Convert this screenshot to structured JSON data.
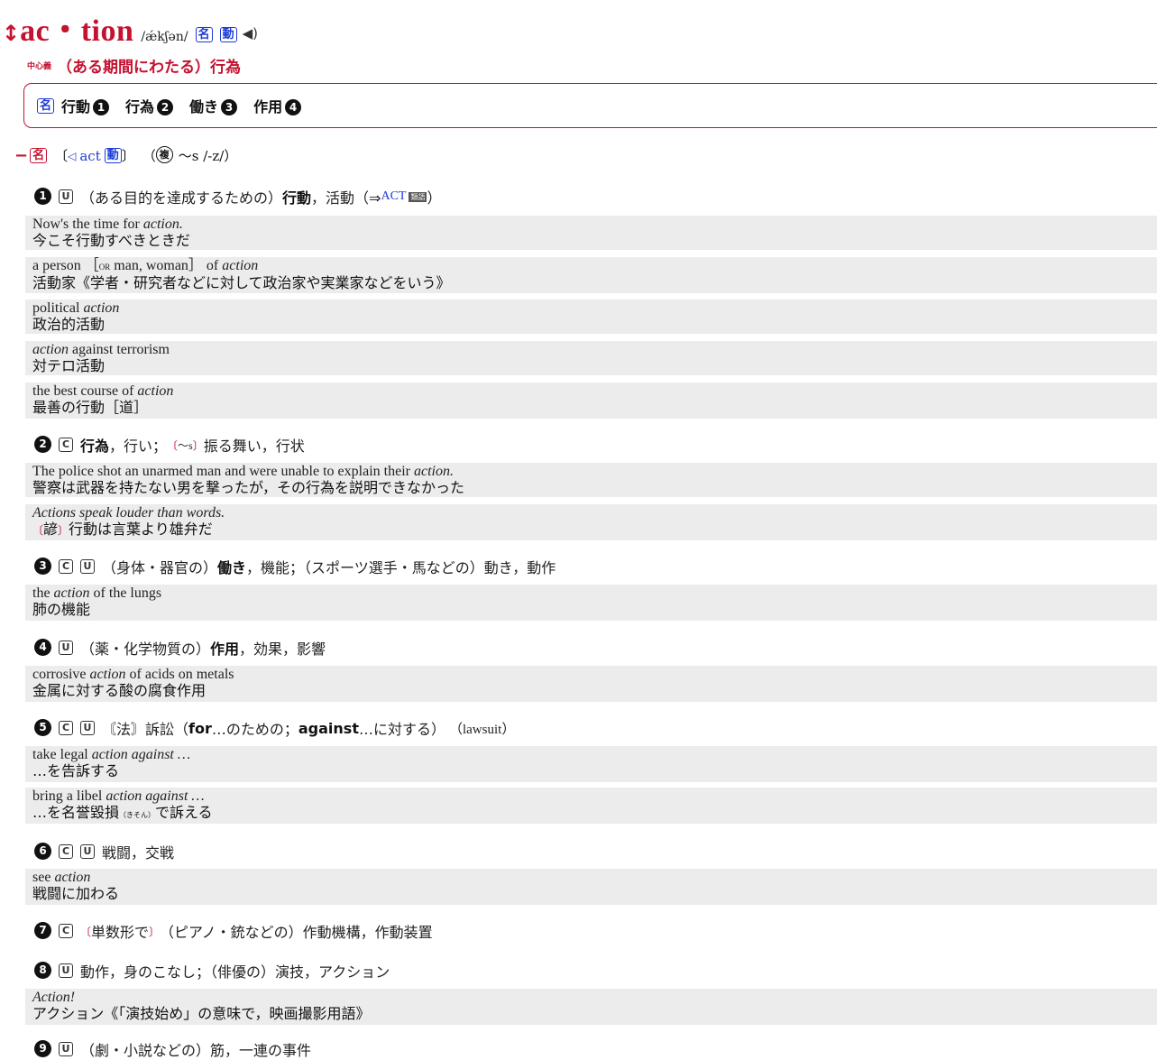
{
  "headword": {
    "mark": "↕",
    "word": "ac・tion",
    "pronunciation": "/ǽkʃən/",
    "pos_labels": [
      "名",
      "動"
    ],
    "speaker_icon": "speaker-icon"
  },
  "core_meaning": {
    "tag": "中心義",
    "text": "（ある期間にわたる）行為"
  },
  "summary": {
    "pos": "名",
    "items": [
      {
        "text": "行動",
        "num": "1"
      },
      {
        "text": "行為",
        "num": "2"
      },
      {
        "text": "働き",
        "num": "3"
      },
      {
        "text": "作用",
        "num": "4"
      }
    ]
  },
  "pos_line": {
    "dash": "−",
    "pos": "名",
    "open": "〔",
    "arrow": "◁",
    "root": "act",
    "root_pos": "動",
    "close": "〕",
    "plural_open": "（",
    "plural_mark": "複",
    "plural": "〜s /-z/",
    "plural_close": "）"
  },
  "senses": [
    {
      "num": "1",
      "grams": [
        "U"
      ],
      "pre": "（ある目的を達成するための）",
      "bold": "行動",
      "post": "，活動（⇒ ",
      "xref": "ACT",
      "xref_tag": "類語",
      "end": "）"
    },
    {
      "num": "2",
      "grams": [
        "C"
      ],
      "bold": "行為",
      "post": "，行い；",
      "bracket_red1": "〔",
      "sub": "〜s",
      "bracket_red2": "〕",
      "post2": "振る舞い，行状"
    },
    {
      "num": "3",
      "grams": [
        "C",
        "U"
      ],
      "pre": "（身体・器官の）",
      "bold": "働き",
      "post": "，機能；（スポーツ選手・馬などの）動き，動作"
    },
    {
      "num": "4",
      "grams": [
        "U"
      ],
      "pre": "（薬・化学物質の）",
      "bold": "作用",
      "post": "，効果，影響"
    },
    {
      "num": "5",
      "grams": [
        "C",
        "U"
      ],
      "pre": "〘法〙訴訟（",
      "b1": "for",
      "m1": " …のための；",
      "b2": "against",
      "m2": " …に対する）",
      "post": "（lawsuit）"
    },
    {
      "num": "6",
      "grams": [
        "C",
        "U"
      ],
      "post": "戦闘，交戦"
    },
    {
      "num": "7",
      "grams": [
        "C"
      ],
      "red1": "〔",
      "pre": "単数形で",
      "red2": "〕",
      "post": "（ピアノ・銃などの）作動機構，作動装置"
    },
    {
      "num": "8",
      "grams": [
        "U"
      ],
      "post": "動作，身のこなし；（俳優の）演技，アクション"
    },
    {
      "num": "9",
      "grams": [
        "U"
      ],
      "pre": "（劇・小説などの）",
      "post": "筋，一連の事件"
    }
  ],
  "examples": [
    {
      "en_pre": "Now's the time for ",
      "en_it": "action.",
      "en_post": "",
      "ja": "今こそ行動すべきときだ"
    },
    {
      "en_pre": "a person ［",
      "en_or": "OR",
      "en_mid": " man, woman］ of ",
      "en_it": "action",
      "en_post": "",
      "ja": "活動家《学者・研究者などに対して政治家や実業家などをいう》"
    },
    {
      "en_pre": "political ",
      "en_it": "action",
      "en_post": "",
      "ja": "政治的活動"
    },
    {
      "en_pre": "",
      "en_it": "action",
      "en_post": " against terrorism",
      "ja": "対テロ活動"
    },
    {
      "en_pre": "the best course of ",
      "en_it": "action",
      "en_post": "",
      "ja": "最善の行動［道］"
    },
    {
      "en_pre": "The police shot an unarmed man and were unable to explain their ",
      "en_it": "action.",
      "en_post": "",
      "ja": "警察は武器を持たない男を撃ったが，その行為を説明できなかった"
    },
    {
      "en_pre": "",
      "en_it": "Actions speak louder than words.",
      "en_post": "",
      "ja_red1": "〔",
      "ja_red_text": "諺",
      "ja_red2": "〕",
      "ja": "行動は言葉より雄弁だ"
    },
    {
      "en_pre": "the ",
      "en_it": "action",
      "en_post": " of the lungs",
      "ja": "肺の機能"
    },
    {
      "en_pre": "corrosive ",
      "en_it": "action",
      "en_post": " of acids on metals",
      "ja": "金属に対する酸の腐食作用"
    },
    {
      "en_pre": "take legal ",
      "en_it": "action against …",
      "en_post": "",
      "ja": "…を告訴する"
    },
    {
      "en_pre": "bring a libel ",
      "en_it": "action against …",
      "en_post": "",
      "ja_pre": "…を名誉毀損",
      "ja_ruby": "（きそん）",
      "ja": "で訴える"
    },
    {
      "en_pre": "see ",
      "en_it": "action",
      "en_post": "",
      "ja": "戦闘に加わる"
    },
    {
      "en_pre": "",
      "en_it": "Action!",
      "en_post": "",
      "ja": "アクション《「演技始め」の意味で，映画撮影用語》"
    }
  ]
}
